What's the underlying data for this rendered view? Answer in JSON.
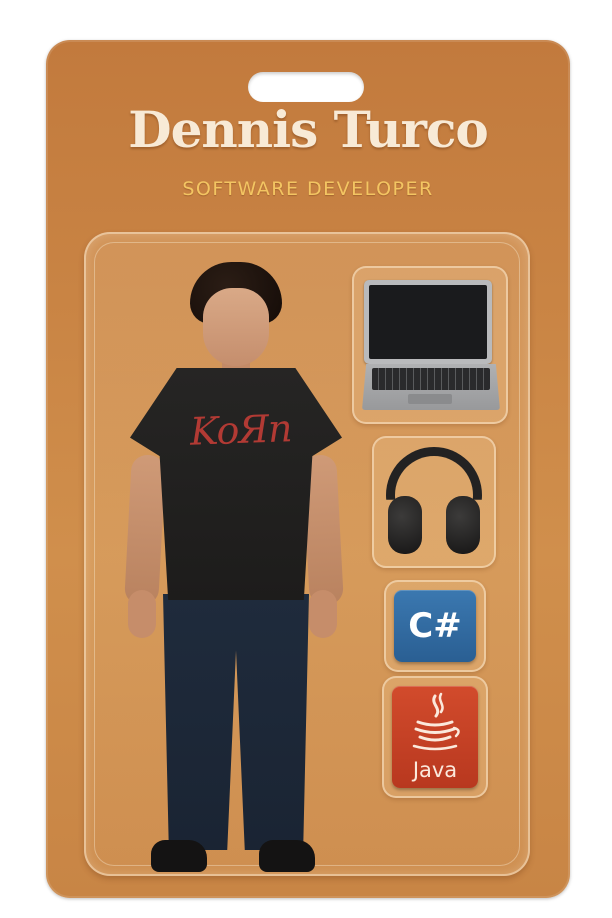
{
  "package": {
    "title": "Dennis Turco",
    "subtitle": "SOFTWARE DEVELOPER",
    "background_color": "#c98444",
    "title_color": "#f8ead6",
    "subtitle_color": "#f3c562"
  },
  "figure": {
    "shirt_print": "KoЯn",
    "shirt_color": "#232221",
    "print_color": "#b23a34"
  },
  "accessories": [
    {
      "name": "laptop",
      "icon": "laptop-icon"
    },
    {
      "name": "headphones",
      "icon": "headphones-icon"
    },
    {
      "name": "csharp",
      "icon": "csharp-logo",
      "label": "C#",
      "color": "#2f6aa3"
    },
    {
      "name": "java",
      "icon": "java-logo",
      "label": "Java",
      "color": "#c4412a"
    }
  ]
}
